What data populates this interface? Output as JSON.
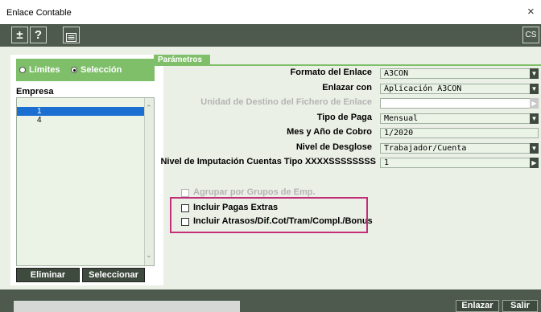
{
  "window": {
    "title": "Enlace Contable",
    "close_glyph": "×"
  },
  "toolbar": {
    "plusminus_label": "±",
    "help_label": "?",
    "list_icon": "list-icon",
    "cs_label": "CS"
  },
  "left_panel": {
    "radio_limites": "Límites",
    "radio_seleccion": "Selección",
    "empresa_label": "Empresa",
    "empresas": [
      "1",
      "4"
    ],
    "eliminar_label": "Eliminar",
    "seleccionar_label": "Seleccionar"
  },
  "params": {
    "tab_label": "Parámetros",
    "formato_label": "Formato del Enlace",
    "formato_value": "A3CON",
    "enlazar_label": "Enlazar con",
    "enlazar_value": "Aplicación A3CON",
    "unidad_label": "Unidad de Destino del Fichero de Enlace",
    "unidad_value": "",
    "tipo_paga_label": "Tipo de Paga",
    "tipo_paga_value": "Mensual",
    "mes_label": "Mes y Año de Cobro",
    "mes_value": " 1/2020",
    "nivel_label": "Nivel de Desglose",
    "nivel_value": "Trabajador/Cuenta",
    "imputacion_label": "Nivel de Imputación Cuentas Tipo XXXXSSSSSSSS",
    "imputacion_value": "1",
    "agrupar_label": "Agrupar por Grupos de Emp.",
    "pagas_label": "Incluir Pagas Extras",
    "atrasos_label": "Incluir Atrasos/Dif.Cot/Tram/Compl./Bonus"
  },
  "bottom": {
    "enlazar_label": "Enlazar",
    "salir_label": "Salir"
  },
  "colors": {
    "accent": "#7fbf6a",
    "dark": "#3e4a3e",
    "highlight": "#c2307a",
    "selection": "#1a6fd1"
  }
}
